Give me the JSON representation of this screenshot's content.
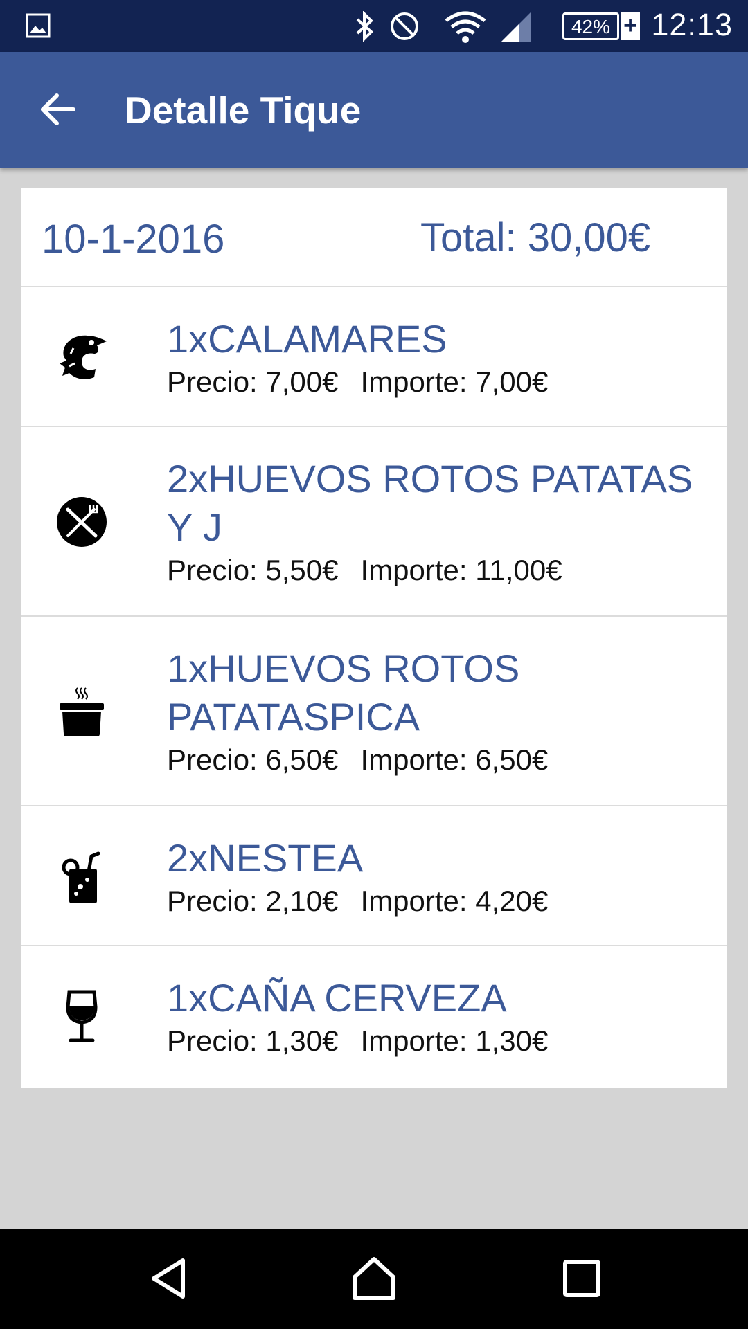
{
  "status_bar": {
    "time": "12:13",
    "battery": "42%",
    "battery_plus": "+"
  },
  "app_bar": {
    "title": "Detalle Tique"
  },
  "ticket": {
    "date": "10-1-2016",
    "total": "Total: 30,00€"
  },
  "items": [
    {
      "name": "1xCALAMARES",
      "price": "Precio: 7,00€",
      "amount": "Importe: 7,00€",
      "icon": "seafood-icon"
    },
    {
      "name": "2xHUEVOS ROTOS PATATAS Y J",
      "price": "Precio: 5,50€",
      "amount": "Importe: 11,00€",
      "icon": "fork-knife-icon"
    },
    {
      "name": "1xHUEVOS ROTOS PATATASPICA",
      "price": "Precio: 6,50€",
      "amount": "Importe: 6,50€",
      "icon": "cooking-pot-icon"
    },
    {
      "name": "2xNESTEA",
      "price": "Precio: 2,10€",
      "amount": "Importe: 4,20€",
      "icon": "soft-drink-icon"
    },
    {
      "name": "1xCAÑA CERVEZA",
      "price": "Precio: 1,30€",
      "amount": "Importe: 1,30€",
      "icon": "wine-glass-icon"
    }
  ],
  "colors": {
    "primary": "#3c5998",
    "status_bar": "#122352",
    "background": "#d4d4d4"
  }
}
